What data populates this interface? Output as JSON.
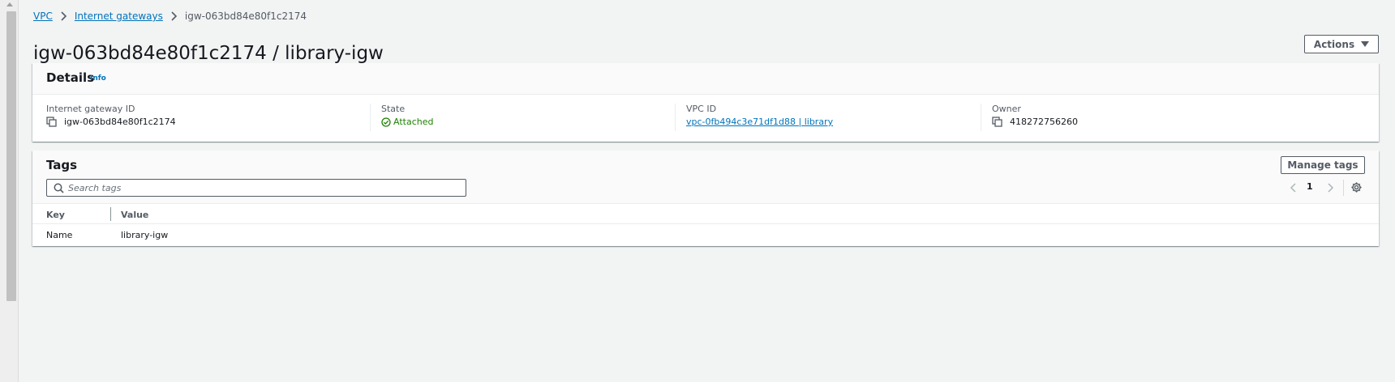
{
  "breadcrumb": {
    "items": [
      {
        "label": "VPC",
        "link": true
      },
      {
        "label": "Internet gateways",
        "link": true
      },
      {
        "label": "igw-063bd84e80f1c2174",
        "link": false
      }
    ]
  },
  "page": {
    "title": "igw-063bd84e80f1c2174 / library-igw",
    "actions_label": "Actions"
  },
  "details": {
    "title": "Details",
    "info_label": "Info",
    "fields": {
      "gateway_id": {
        "label": "Internet gateway ID",
        "value": "igw-063bd84e80f1c2174"
      },
      "state": {
        "label": "State",
        "value": "Attached"
      },
      "vpc_id": {
        "label": "VPC ID",
        "value": "vpc-0fb494c3e71df1d88 | library"
      },
      "owner": {
        "label": "Owner",
        "value": "418272756260"
      }
    }
  },
  "tags": {
    "title": "Tags",
    "manage_label": "Manage tags",
    "search_placeholder": "Search tags",
    "page_number": "1",
    "columns": [
      "Key",
      "Value"
    ],
    "rows": [
      {
        "key": "Name",
        "value": "library-igw"
      }
    ]
  },
  "colors": {
    "link": "#0073bb",
    "success": "#1d8102",
    "background": "#f2f3f3"
  }
}
